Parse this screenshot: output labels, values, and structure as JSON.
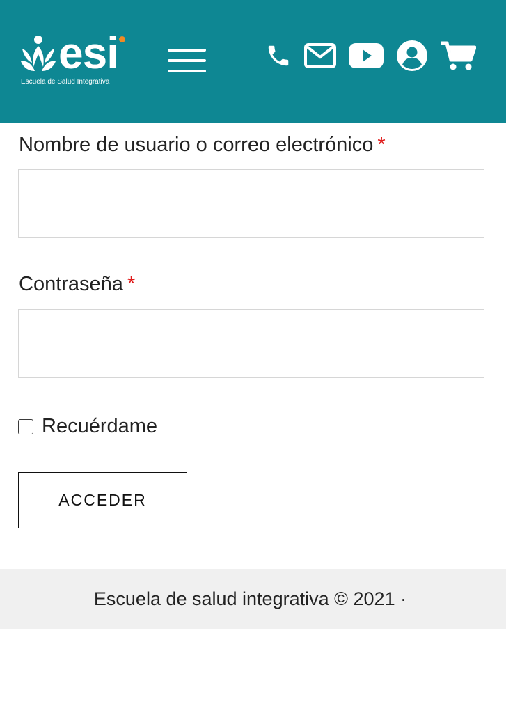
{
  "brand": {
    "name": "esi",
    "tagline": "Escuela de Salud Integrativa",
    "color": "#0e8793",
    "accent": "#f08a24"
  },
  "header": {
    "icons": [
      "menu-icon",
      "phone-icon",
      "mail-icon",
      "youtube-icon",
      "user-icon",
      "cart-icon"
    ]
  },
  "form": {
    "username": {
      "label": "Nombre de usuario o correo electrónico",
      "required_mark": "*",
      "value": ""
    },
    "password": {
      "label": "Contraseña",
      "required_mark": "*",
      "value": ""
    },
    "remember": {
      "label": "Recuérdame",
      "checked": false
    },
    "submit_label": "ACCEDER",
    "required_color": "#e01b1b"
  },
  "footer": {
    "text": "Escuela de salud integrativa © 2021 ·"
  }
}
